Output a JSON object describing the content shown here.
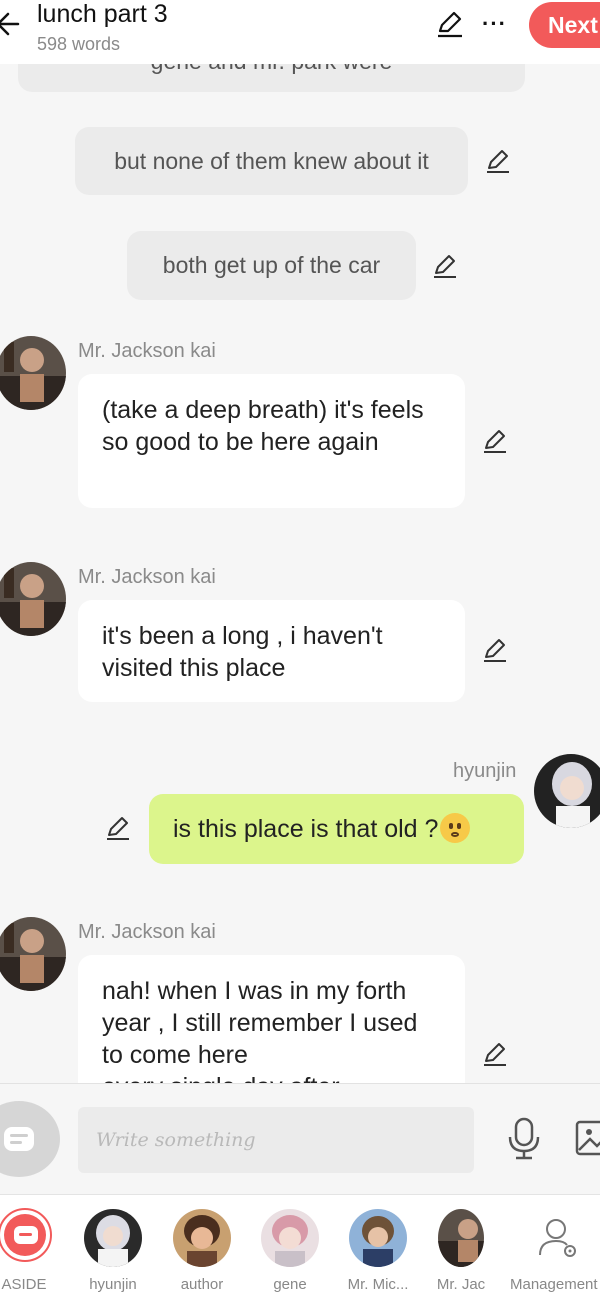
{
  "header": {
    "title": "lunch part 3",
    "word_count": "598 words",
    "next_label": "Next",
    "more_label": "···"
  },
  "chat": {
    "clipped_aside": "gene and mr. park were",
    "asides": [
      "but none of them knew about it",
      "both get up of the car"
    ],
    "messages": [
      {
        "speaker": "Mr. Jackson kai",
        "text": "(take a deep breath) it's feels so good to be here again"
      },
      {
        "speaker": "Mr. Jackson kai",
        "text": "it's been a long , i haven't visited this place"
      },
      {
        "speaker": "hyunjin",
        "text": "is this place is that old ?",
        "emoji": "worried-face"
      },
      {
        "speaker": "Mr. Jackson kai",
        "text": "nah! when I was in my forth year , I still remember I used to come here",
        "clipped_tail": "every single day after"
      }
    ]
  },
  "composer": {
    "placeholder": "Write something"
  },
  "cast_bar": {
    "items": [
      {
        "label": "ASIDE"
      },
      {
        "label": "hyunjin"
      },
      {
        "label": "author"
      },
      {
        "label": "gene"
      },
      {
        "label": "Mr. Mic..."
      },
      {
        "label": "Mr. Jac"
      },
      {
        "label": "Management"
      }
    ]
  },
  "colors": {
    "accent": "#f25a5a",
    "my_bubble": "#dcf58c",
    "aside_bubble": "#ebebeb",
    "background": "#f6f6f6"
  }
}
